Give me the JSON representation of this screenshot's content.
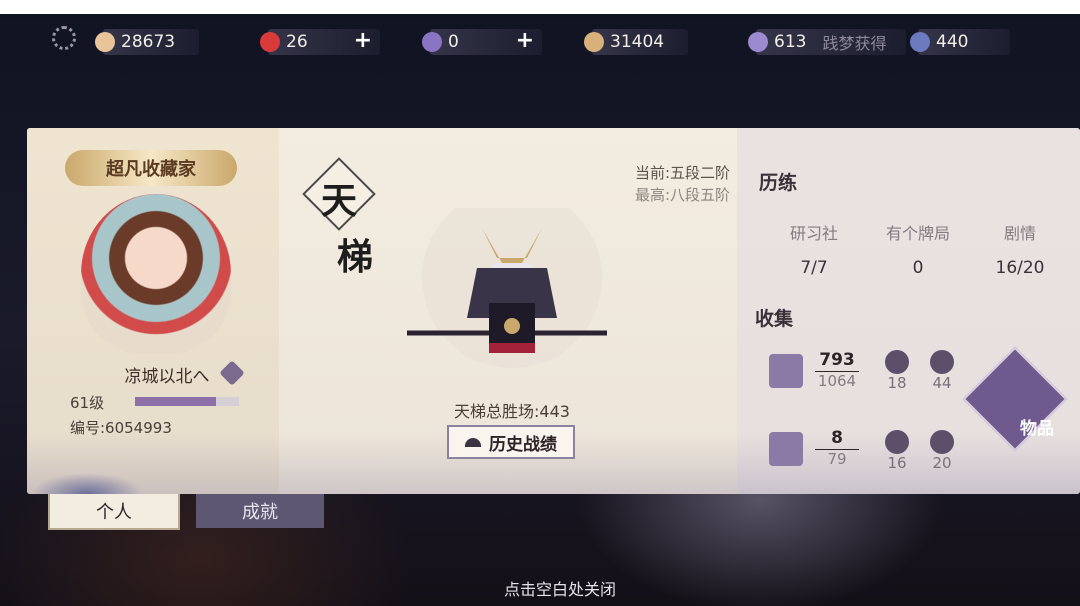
{
  "resources": [
    {
      "name": "coin",
      "value": "28673",
      "has_plus": false,
      "color": "#e9c49a"
    },
    {
      "name": "stamina",
      "value": "26",
      "has_plus": true,
      "color": "#d93b3b"
    },
    {
      "name": "jade",
      "value": "0",
      "has_plus": true,
      "color": "#8a74c4"
    },
    {
      "name": "currency-3",
      "value": "31404",
      "has_plus": false,
      "color": "#d7b07a"
    },
    {
      "name": "currency-4",
      "value": "613",
      "has_plus": false,
      "color": "#9b8ad0"
    },
    {
      "name": "crystal",
      "value": "440",
      "has_plus": false,
      "color": "#6c7bc0"
    }
  ],
  "ticker_text": "践梦获得",
  "profile": {
    "badge": "超凡收藏家",
    "name": "凉城以北へ",
    "level_label": "61级",
    "level_progress": 0.78,
    "uid_label": "编号:6054993"
  },
  "ladder": {
    "title_char1": "天",
    "title_char2": "梯",
    "current_rank": "当前:五段二阶",
    "best_rank": "最高:八段五阶",
    "total_wins": "天梯总胜场:443",
    "history_button": "历史战绩"
  },
  "training": {
    "title": "历练",
    "items": [
      {
        "label": "研习社",
        "value": "7/7"
      },
      {
        "label": "有个牌局",
        "value": "0"
      },
      {
        "label": "剧情",
        "value": "16/20"
      }
    ]
  },
  "collection": {
    "title": "收集",
    "book": {
      "numerator": "793",
      "denominator": "1064"
    },
    "robe": {
      "numerator": "8",
      "denominator": "79"
    },
    "small": [
      {
        "name": "cards",
        "value": "18"
      },
      {
        "name": "bomb",
        "value": "44"
      },
      {
        "name": "flame",
        "value": "16"
      },
      {
        "name": "stamp",
        "value": "20"
      }
    ],
    "items_label": "物品"
  },
  "tabs": {
    "personal": "个人",
    "achievement": "成就"
  },
  "close_hint": "点击空白处关闭"
}
